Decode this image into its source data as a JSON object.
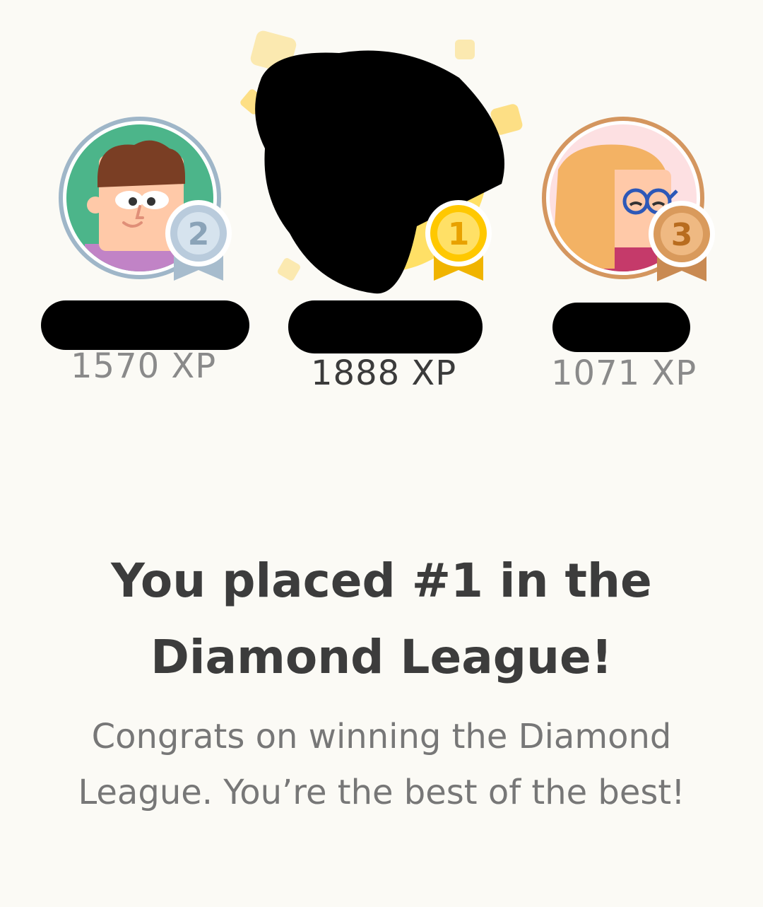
{
  "podium": {
    "first": {
      "rank": "1",
      "xp": "1888 XP",
      "medal": "gold-medal-icon"
    },
    "second": {
      "rank": "2",
      "xp": "1570 XP",
      "medal": "silver-medal-icon"
    },
    "third": {
      "rank": "3",
      "xp": "1071 XP",
      "medal": "bronze-medal-icon"
    }
  },
  "result": {
    "headline": "You placed #1 in the Diamond League!",
    "message": "Congrats on winning the Diamond League. You’re the best of the best!"
  },
  "colors": {
    "background": "#fbfaf5",
    "gold": "#ffc800",
    "silver": "#b9cbdc",
    "bronze": "#d99a5c",
    "headline": "#3c3c3c",
    "body": "#777777"
  }
}
